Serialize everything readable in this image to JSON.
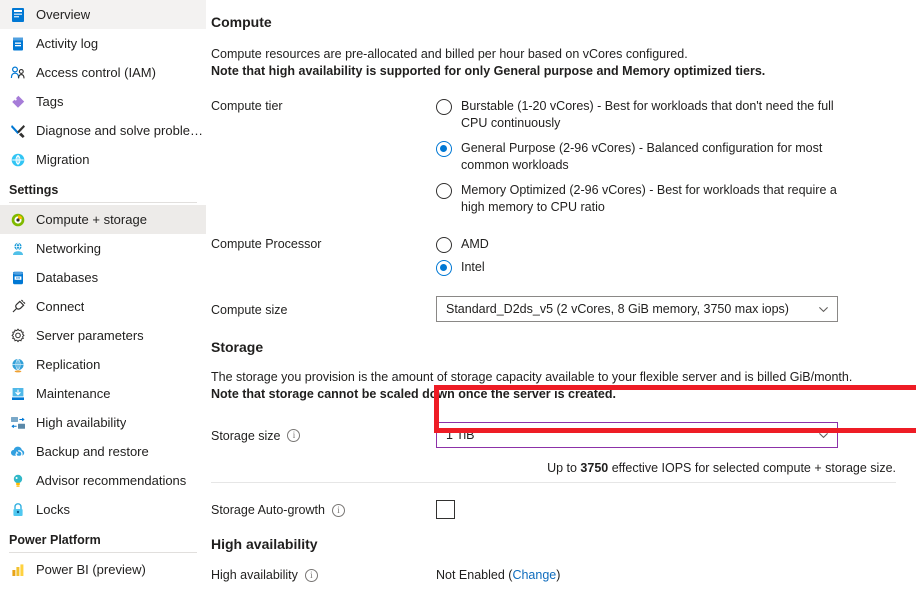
{
  "sidebar": {
    "items": [
      {
        "label": "Overview",
        "icon": "overview-icon",
        "selected": false
      },
      {
        "label": "Activity log",
        "icon": "activity-log-icon",
        "selected": false
      },
      {
        "label": "Access control (IAM)",
        "icon": "access-control-icon",
        "selected": false
      },
      {
        "label": "Tags",
        "icon": "tags-icon",
        "selected": false
      },
      {
        "label": "Diagnose and solve problems",
        "icon": "diagnose-icon",
        "selected": false
      },
      {
        "label": "Migration",
        "icon": "migration-icon",
        "selected": false
      }
    ],
    "settings_header": "Settings",
    "settings_items": [
      {
        "label": "Compute + storage",
        "icon": "compute-storage-icon",
        "selected": true
      },
      {
        "label": "Networking",
        "icon": "networking-icon",
        "selected": false
      },
      {
        "label": "Databases",
        "icon": "databases-icon",
        "selected": false
      },
      {
        "label": "Connect",
        "icon": "connect-icon",
        "selected": false
      },
      {
        "label": "Server parameters",
        "icon": "server-parameters-icon",
        "selected": false
      },
      {
        "label": "Replication",
        "icon": "replication-icon",
        "selected": false
      },
      {
        "label": "Maintenance",
        "icon": "maintenance-icon",
        "selected": false
      },
      {
        "label": "High availability",
        "icon": "high-availability-icon",
        "selected": false
      },
      {
        "label": "Backup and restore",
        "icon": "backup-restore-icon",
        "selected": false
      },
      {
        "label": "Advisor recommendations",
        "icon": "advisor-icon",
        "selected": false
      },
      {
        "label": "Locks",
        "icon": "locks-icon",
        "selected": false
      }
    ],
    "power_platform_header": "Power Platform",
    "power_platform_items": [
      {
        "label": "Power BI (preview)",
        "icon": "power-bi-icon",
        "selected": false
      }
    ]
  },
  "compute": {
    "heading": "Compute",
    "desc_line1": "Compute resources are pre-allocated and billed per hour based on vCores configured.",
    "desc_line2": "Note that high availability is supported for only General purpose and Memory optimized tiers.",
    "tier_label": "Compute tier",
    "tier_options": [
      {
        "label": "Burstable (1-20 vCores) - Best for workloads that don't need the full CPU continuously",
        "checked": false
      },
      {
        "label": "General Purpose (2-96 vCores) - Balanced configuration for most common workloads",
        "checked": true
      },
      {
        "label": "Memory Optimized (2-96 vCores) - Best for workloads that require a high memory to CPU ratio",
        "checked": false
      }
    ],
    "processor_label": "Compute Processor",
    "processor_options": [
      {
        "label": "AMD",
        "checked": false
      },
      {
        "label": "Intel",
        "checked": true
      }
    ],
    "size_label": "Compute size",
    "size_value": "Standard_D2ds_v5 (2 vCores, 8 GiB memory, 3750 max iops)"
  },
  "storage": {
    "heading": "Storage",
    "desc_line1": "The storage you provision is the amount of storage capacity available to your flexible server and is billed GiB/month.",
    "desc_line2": "Note that storage cannot be scaled down once the server is created.",
    "size_label": "Storage size",
    "size_value": "1 TiB",
    "iops_prefix": "Up to ",
    "iops_value": "3750",
    "iops_suffix": " effective IOPS for selected compute + storage size.",
    "autogrow_label": "Storage Auto-growth",
    "autogrow_checked": false
  },
  "high_availability": {
    "heading": "High availability",
    "label": "High availability",
    "value": "Not Enabled (",
    "change_link": "Change",
    "value_close": ")"
  },
  "colors": {
    "accent": "#0078d4",
    "link": "#0f6cbd",
    "highlight_box": "#ee1c25",
    "focus_border": "#8c31a8",
    "selected_nav_bg": "#edebe9"
  }
}
